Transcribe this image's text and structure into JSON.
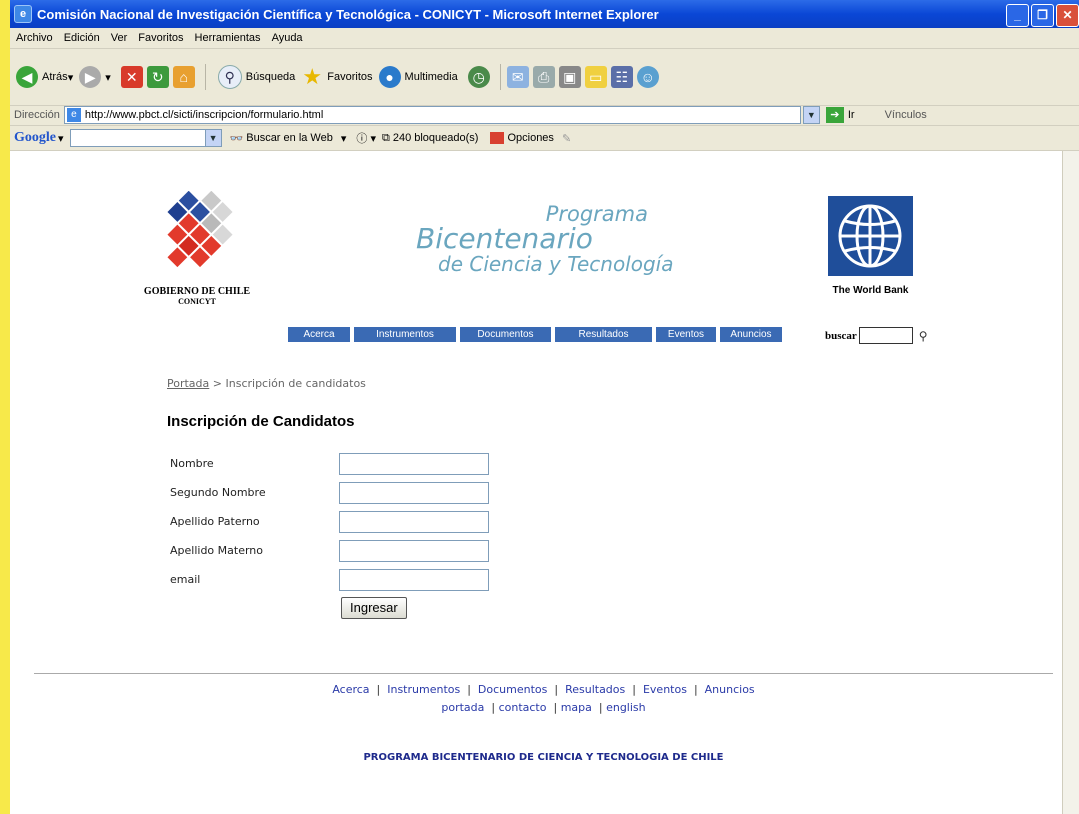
{
  "window": {
    "title": "Comisión Nacional de Investigación Científica y Tecnológica - CONICYT - Microsoft Internet Explorer"
  },
  "menu": [
    "Archivo",
    "Edición",
    "Ver",
    "Favoritos",
    "Herramientas",
    "Ayuda"
  ],
  "toolbar": {
    "back": "Atrás",
    "search": "Búsqueda",
    "favorites": "Favoritos",
    "media": "Multimedia"
  },
  "address": {
    "label": "Dirección",
    "url": "http://www.pbct.cl/sicti/inscripcion/formulario.html",
    "go": "Ir",
    "links": "Vínculos"
  },
  "google": {
    "logo": "Google",
    "search_web": "Buscar en la Web",
    "blocked": "240 bloqueado(s)",
    "options": "Opciones"
  },
  "header": {
    "gov_line1": "GOBIERNO DE CHILE",
    "gov_line2": "CONICYT",
    "program_line1": "Programa",
    "program_line2": "Bicentenario",
    "program_line3": "de Ciencia y Tecnología",
    "worldbank": "The World Bank"
  },
  "nav": [
    "Acerca",
    "Instrumentos",
    "Documentos",
    "Resultados",
    "Eventos",
    "Anuncios"
  ],
  "search": {
    "label": "buscar"
  },
  "breadcrumb": {
    "home": "Portada",
    "sep": ">",
    "current": "Inscripción de candidatos"
  },
  "form": {
    "title": "Inscripción de Candidatos",
    "fields": [
      "Nombre",
      "Segundo Nombre",
      "Apellido Paterno",
      "Apellido Materno",
      "email"
    ],
    "submit": "Ingresar"
  },
  "footer": {
    "links1": [
      "Acerca",
      "Instrumentos",
      "Documentos",
      "Resultados",
      "Eventos",
      "Anuncios"
    ],
    "links2": [
      "portada",
      "contacto",
      "mapa",
      "english"
    ],
    "copyright": "PROGRAMA BICENTENARIO DE CIENCIA Y TECNOLOGIA DE CHILE"
  },
  "colors": {
    "nav": "#3a6ab4",
    "brand_text": "#6aa6bf",
    "link": "#2a3aa8"
  }
}
